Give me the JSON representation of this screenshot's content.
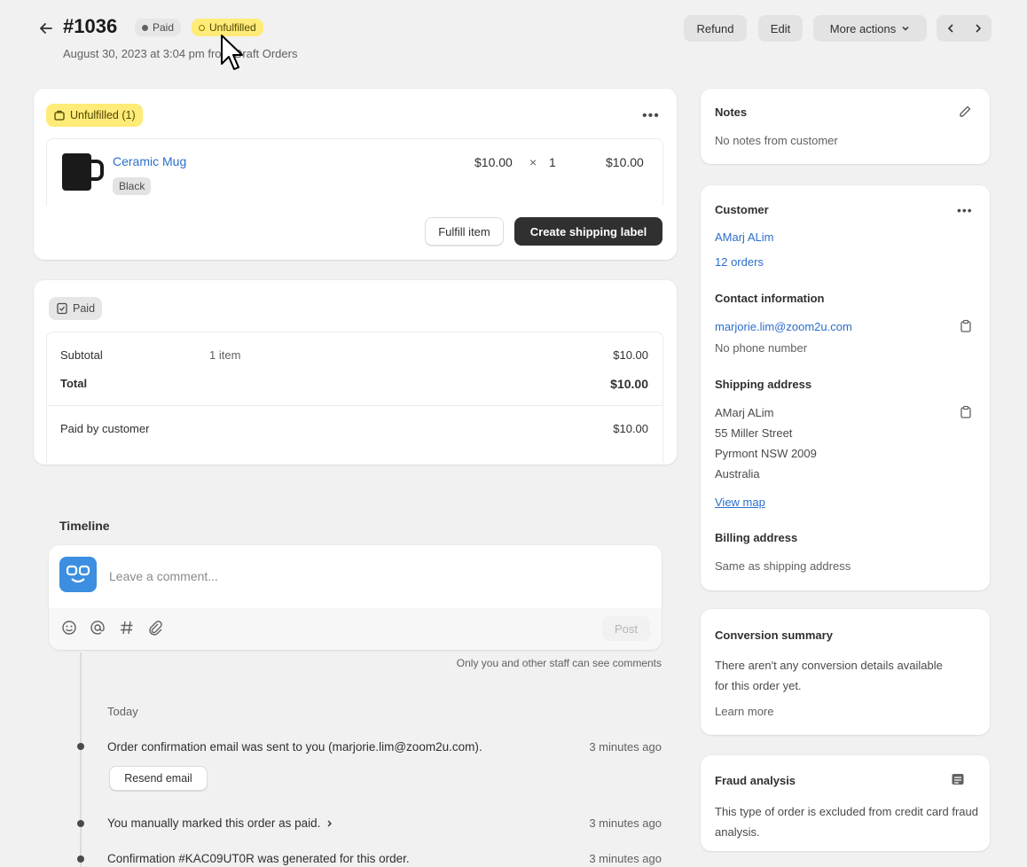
{
  "header": {
    "order_number": "#1036",
    "paid_badge": "Paid",
    "unfulfilled_badge": "Unfulfilled",
    "date_text": "August 30, 2023 at 3:04 pm from Draft Orders",
    "refund_label": "Refund",
    "edit_label": "Edit",
    "more_actions_label": "More actions"
  },
  "fulfillment": {
    "badge": "Unfulfilled (1)",
    "product_name": "Ceramic Mug",
    "variant": "Black",
    "unit_price": "$10.00",
    "times": "×",
    "quantity": "1",
    "line_total": "$10.00",
    "fulfill_label": "Fulfill item",
    "shipping_label": "Create shipping label"
  },
  "payment": {
    "badge": "Paid",
    "subtotal_label": "Subtotal",
    "subtotal_items": "1 item",
    "subtotal_value": "$10.00",
    "total_label": "Total",
    "total_value": "$10.00",
    "paid_by_label": "Paid by customer",
    "paid_by_value": "$10.00"
  },
  "timeline": {
    "title": "Timeline",
    "comment_placeholder": "Leave a comment...",
    "post_label": "Post",
    "staff_note": "Only you and other staff can see comments",
    "day_label": "Today",
    "events": [
      {
        "text": "Order confirmation email was sent to you (marjorie.lim@zoom2u.com).",
        "time": "3 minutes ago"
      },
      {
        "text": "You manually marked this order as paid.",
        "time": "3 minutes ago"
      },
      {
        "text": "Confirmation #KAC09UT0R was generated for this order.",
        "time": "3 minutes ago"
      }
    ],
    "resend_label": "Resend email"
  },
  "notes": {
    "title": "Notes",
    "text": "No notes from customer"
  },
  "customer": {
    "title": "Customer",
    "name": "AMarj ALim",
    "orders": "12 orders",
    "contact_title": "Contact information",
    "email": "marjorie.lim@zoom2u.com",
    "phone": "No phone number",
    "shipping_title": "Shipping address",
    "address": [
      "AMarj ALim",
      "55 Miller Street",
      "Pyrmont NSW 2009",
      "Australia"
    ],
    "view_map": "View map",
    "billing_title": "Billing address",
    "billing_text": "Same as shipping address"
  },
  "conversion": {
    "title": "Conversion summary",
    "text": "There aren't any conversion details available for this order yet.",
    "learn_more": "Learn more"
  },
  "fraud": {
    "title": "Fraud analysis",
    "text": "This type of order is excluded from credit card fraud analysis."
  },
  "colors": {
    "unfulfilled_bg": "#ffeb78",
    "primary_button": "#303030",
    "link": "#2c6ecb",
    "avatar": "#3b8ee0"
  }
}
